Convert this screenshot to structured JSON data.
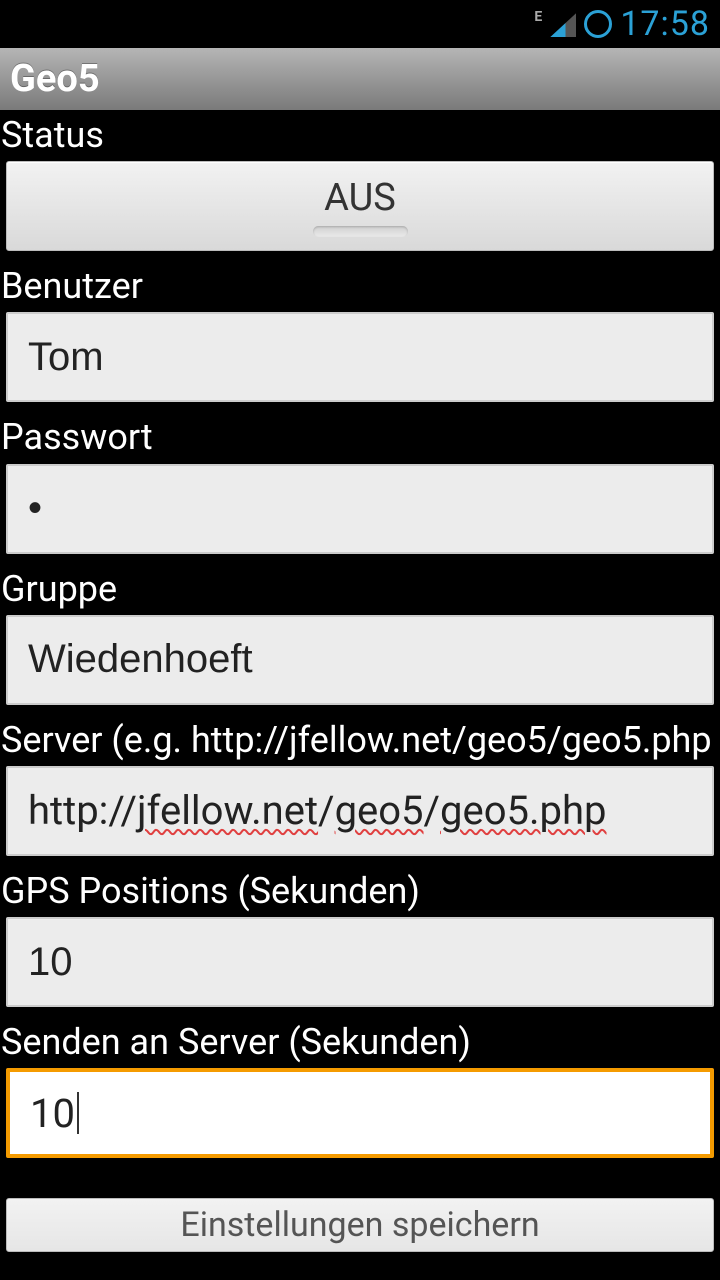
{
  "statusbar": {
    "network_badge": "E",
    "clock": "17:58"
  },
  "titlebar": {
    "title": "Geo5"
  },
  "labels": {
    "status": "Status",
    "user": "Benutzer",
    "password": "Passwort",
    "group": "Gruppe",
    "server": "Server (e.g. http://jfellow.net/geo5/geo5.php",
    "gps_interval": "GPS Positions (Sekunden)",
    "send_interval": "Senden an Server (Sekunden)"
  },
  "fields": {
    "status_toggle": "AUS",
    "user": "Tom",
    "password_mask": "•",
    "group": "Wiedenhoeft",
    "server_prefix": "http://",
    "server_parts": [
      "jfellow.net",
      "/",
      "geo5",
      "/",
      "geo5.php"
    ],
    "gps_interval": "10",
    "send_interval": "10"
  },
  "buttons": {
    "save": "Einstellungen speichern"
  }
}
